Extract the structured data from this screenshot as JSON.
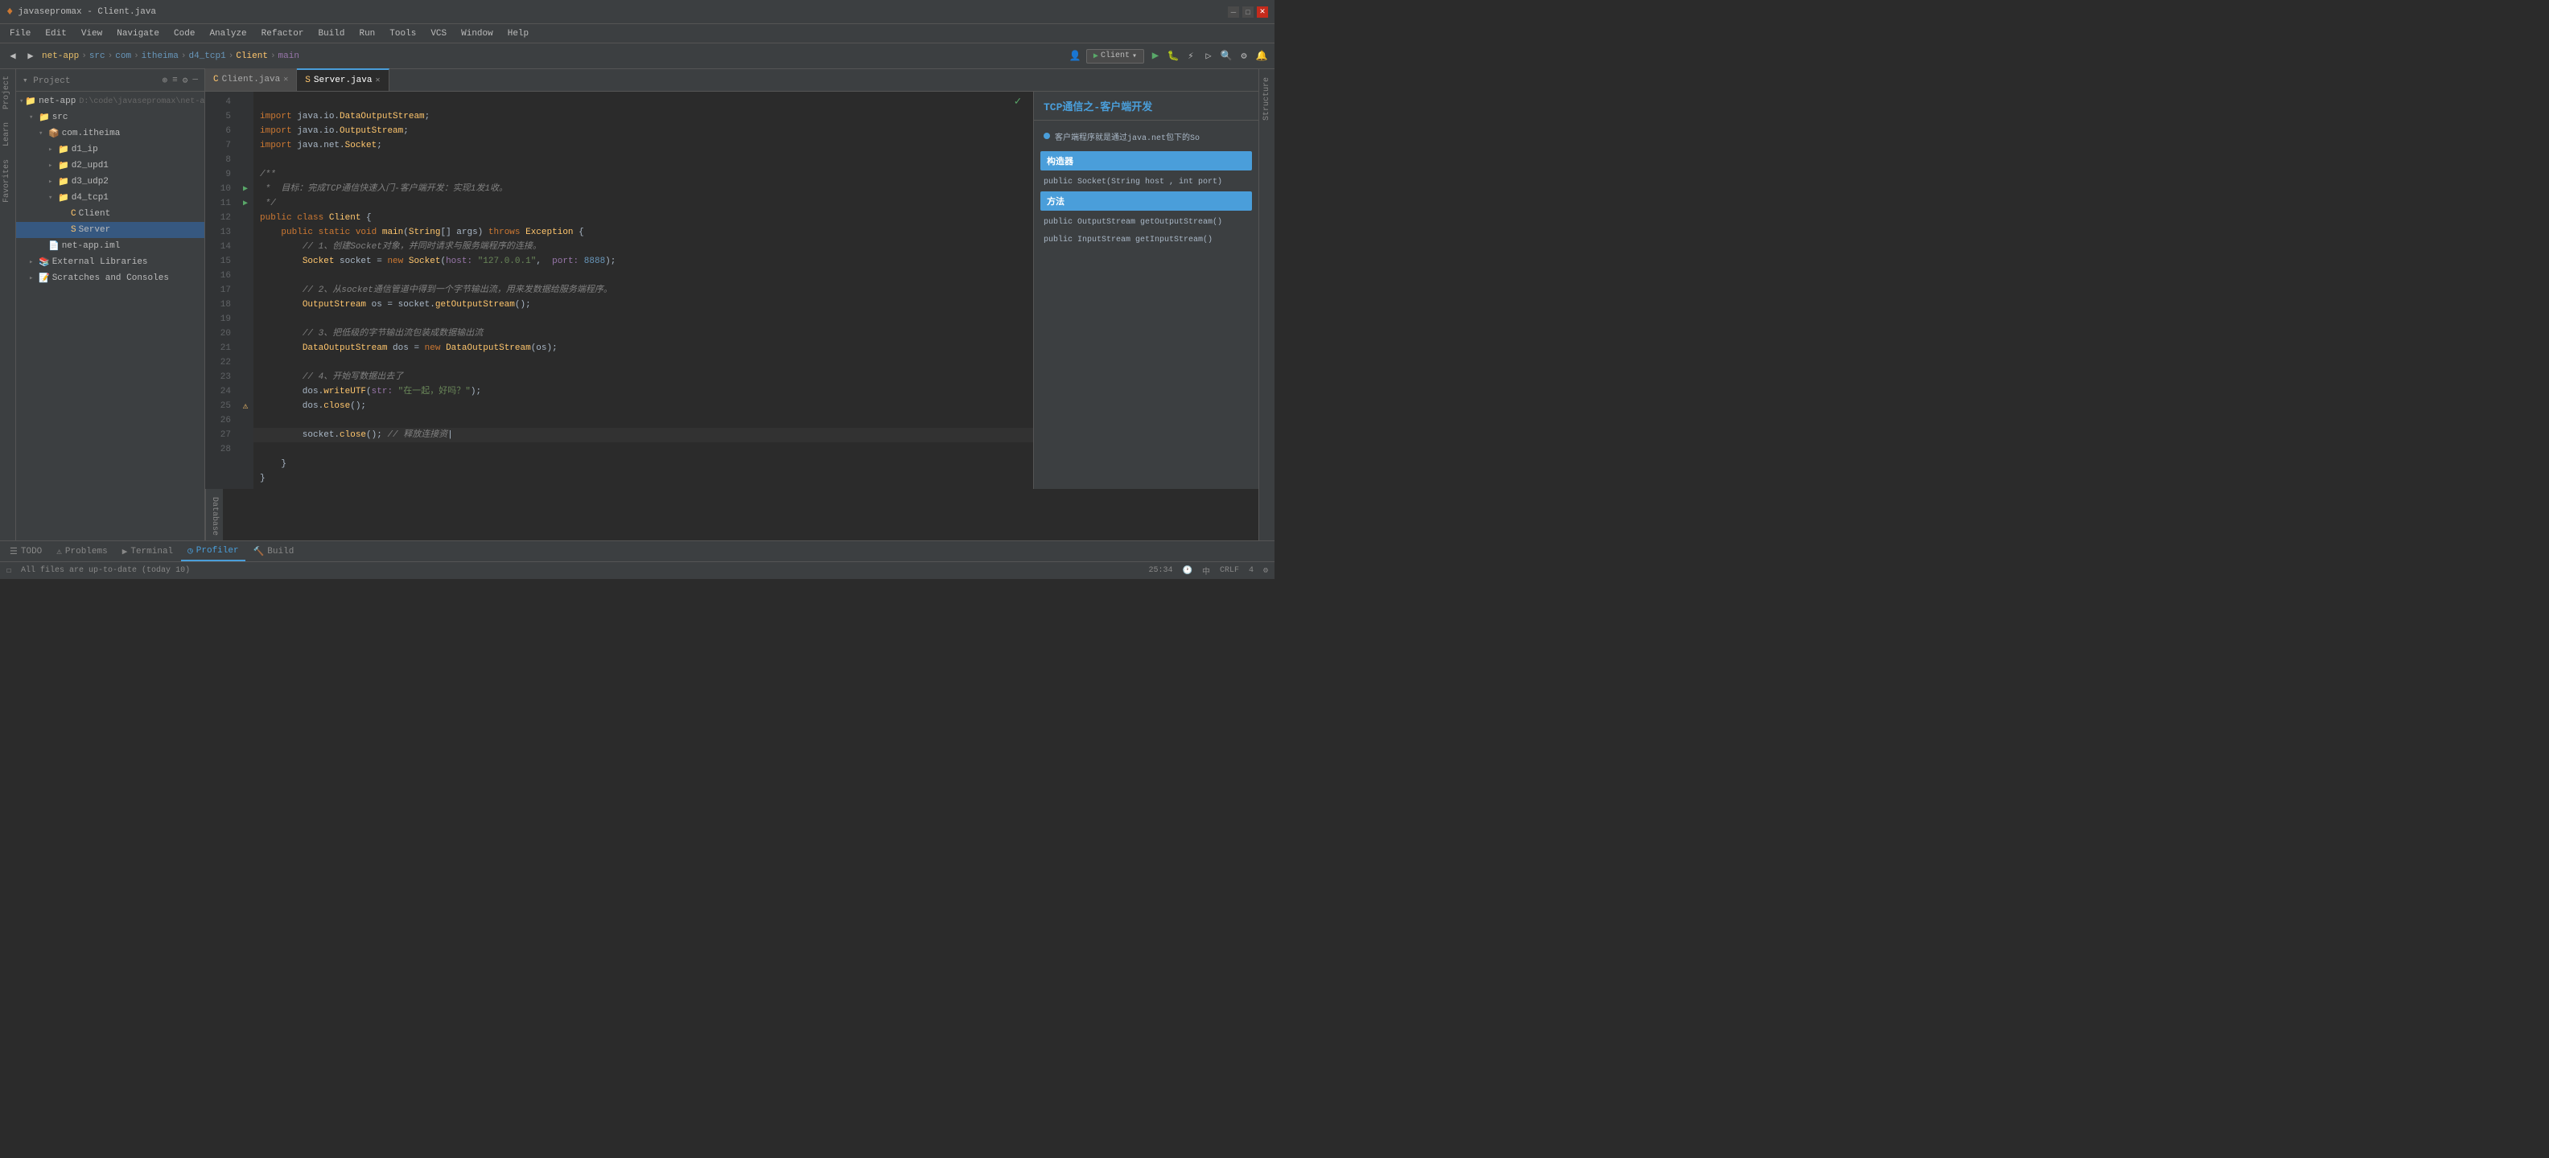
{
  "titlebar": {
    "title": "javasepromax - Client.java",
    "logo": "♦"
  },
  "menubar": {
    "items": [
      "File",
      "Edit",
      "View",
      "Navigate",
      "Code",
      "Analyze",
      "Refactor",
      "Build",
      "Run",
      "Tools",
      "VCS",
      "Window",
      "Help"
    ]
  },
  "toolbar": {
    "breadcrumbs": [
      "net-app",
      "src",
      "com",
      "itheima",
      "d4_tcp1",
      "Client",
      "main"
    ],
    "run_config": "Client"
  },
  "project": {
    "header": "Project",
    "tree": [
      {
        "id": "net-app",
        "label": "net-app",
        "path": "D:\\code\\javasepromax\\net-app",
        "level": 0,
        "expanded": true,
        "type": "root"
      },
      {
        "id": "src",
        "label": "src",
        "level": 1,
        "expanded": true,
        "type": "folder"
      },
      {
        "id": "com.itheima",
        "label": "com.itheima",
        "level": 2,
        "expanded": true,
        "type": "package"
      },
      {
        "id": "d1_ip",
        "label": "d1_ip",
        "level": 3,
        "expanded": false,
        "type": "package"
      },
      {
        "id": "d2_upd1",
        "label": "d2_upd1",
        "level": 3,
        "expanded": false,
        "type": "package"
      },
      {
        "id": "d3_udp2",
        "label": "d3_udp2",
        "level": 3,
        "expanded": false,
        "type": "package"
      },
      {
        "id": "d4_tcp1",
        "label": "d4_tcp1",
        "level": 3,
        "expanded": true,
        "type": "package"
      },
      {
        "id": "Client",
        "label": "Client",
        "level": 4,
        "type": "java"
      },
      {
        "id": "Server",
        "label": "Server",
        "level": 4,
        "type": "java",
        "selected": true
      },
      {
        "id": "net-app.iml",
        "label": "net-app.iml",
        "level": 2,
        "type": "iml"
      },
      {
        "id": "External Libraries",
        "label": "External Libraries",
        "level": 1,
        "type": "lib"
      },
      {
        "id": "Scratches and Consoles",
        "label": "Scratches and Consoles",
        "level": 1,
        "type": "scratch"
      }
    ]
  },
  "tabs": [
    {
      "label": "Client.java",
      "active": false,
      "icon": "C"
    },
    {
      "label": "Server.java",
      "active": true,
      "icon": "S"
    }
  ],
  "code": {
    "lines": [
      {
        "n": 4,
        "content": "    import java.io.DataOutputStream;"
      },
      {
        "n": 5,
        "content": "    import java.io.OutputStream;"
      },
      {
        "n": 6,
        "content": "    import java.net.Socket;"
      },
      {
        "n": 7,
        "content": ""
      },
      {
        "n": 7,
        "content": "    /**"
      },
      {
        "n": 8,
        "content": "     *  目标：完成TCP通信快速入门-客户端开发：实现1发1收。"
      },
      {
        "n": 9,
        "content": "     */"
      },
      {
        "n": 10,
        "content": "    public class Client {"
      },
      {
        "n": 11,
        "content": "        public static void main(String[] args) throws Exception {"
      },
      {
        "n": 12,
        "content": "            // 1、创建Socket对象，并同时请求与服务端程序的连接。"
      },
      {
        "n": 13,
        "content": "            Socket socket = new Socket( host: \"127.0.0.1\",  port: 8888);"
      },
      {
        "n": 14,
        "content": ""
      },
      {
        "n": 15,
        "content": "            // 2、从socket通信管道中得到一个字节输出流，用来发数据给服务端程序。"
      },
      {
        "n": 16,
        "content": "            OutputStream os = socket.getOutputStream();"
      },
      {
        "n": 17,
        "content": ""
      },
      {
        "n": 18,
        "content": "            // 3、把低级的字节输出流包装成数据输出流"
      },
      {
        "n": 19,
        "content": "            DataOutputStream dos = new DataOutputStream(os);"
      },
      {
        "n": 20,
        "content": ""
      },
      {
        "n": 21,
        "content": "            // 4、开始写数据出去了"
      },
      {
        "n": 22,
        "content": "            dos.writeUTF( str: \"在一起，好吗？\");"
      },
      {
        "n": 23,
        "content": "            dos.close();"
      },
      {
        "n": 24,
        "content": ""
      },
      {
        "n": 25,
        "content": "            socket.close(); // 释放连接资"
      },
      {
        "n": 26,
        "content": "        }"
      },
      {
        "n": 27,
        "content": "    }"
      },
      {
        "n": 28,
        "content": ""
      }
    ]
  },
  "popup": {
    "title": "TCP通信之-客户端开发",
    "bullet": "客户端程序就是通过java.net包下的So",
    "section1": "构造器",
    "method1": "public Socket(String host , int port)",
    "section2": "方法",
    "method2": "public OutputStream getOutputStream()",
    "method3": "public InputStream getInputStream()"
  },
  "bottom_tabs": [
    {
      "label": "TODO",
      "icon": "☰"
    },
    {
      "label": "Problems",
      "icon": "⚠"
    },
    {
      "label": "Terminal",
      "icon": "▶"
    },
    {
      "label": "Profiler",
      "icon": "◷"
    },
    {
      "label": "Build",
      "icon": "🔨"
    }
  ],
  "statusbar": {
    "message": "All files are up-to-date (today 10)",
    "position": "25:34",
    "encoding": "中",
    "crlf": "CRLF",
    "indent": "4"
  },
  "side_tabs": {
    "left": [
      "Project",
      "Learn",
      "Favorites"
    ],
    "right": [
      "Database",
      "Structure"
    ]
  }
}
